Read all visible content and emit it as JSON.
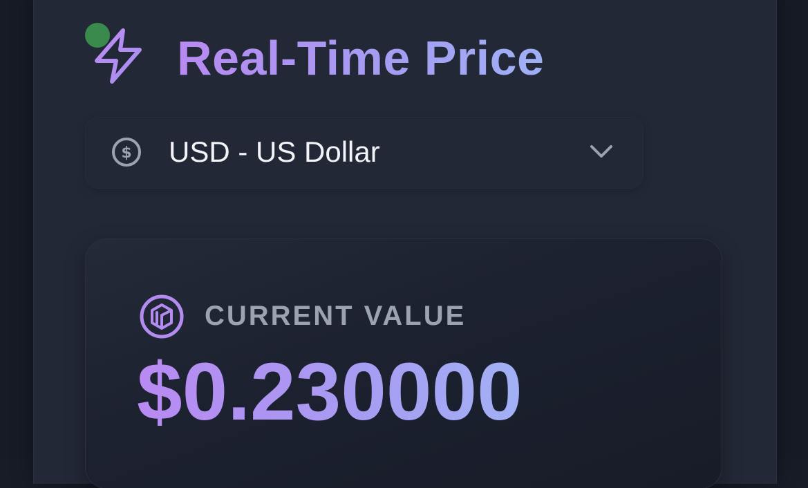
{
  "header": {
    "title": "Real-Time Price",
    "icon": "lightning-bolt-icon",
    "status_indicator_color": "#3b8a4d"
  },
  "currency_select": {
    "icon": "dollar-circle-icon",
    "selected_label": "USD - US Dollar",
    "chevron": "chevron-down-icon"
  },
  "value_card": {
    "icon": "cube-coin-icon",
    "caption": "CURRENT VALUE",
    "price": "$0.230000"
  },
  "colors": {
    "background": "#161b26",
    "panel": "#222836",
    "accent_gradient_start": "#b98af2",
    "accent_gradient_end": "#9fb0f5",
    "muted_text": "#9ca3af",
    "primary_text": "#f3f4f7"
  }
}
